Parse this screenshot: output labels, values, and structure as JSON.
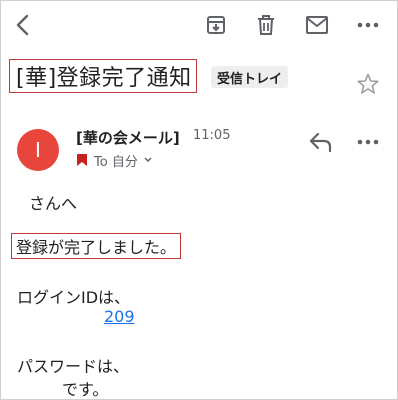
{
  "email": {
    "subject": "[華]登録完了通知",
    "label": "受信トレイ",
    "sender_initial": "I",
    "sender_name": "[華の会メール]",
    "time": "11:05",
    "recipient": "To 自分",
    "body": {
      "greeting": "さんへ",
      "message": "登録が完了しました。",
      "login_id_label": "ログインIDは、",
      "login_id_value": "209",
      "password_label": "パスワードは、",
      "password_suffix": "です。"
    }
  },
  "colors": {
    "avatar": "#e8453c",
    "highlight_border": "#c0393b",
    "link": "#1a73e8",
    "icon": "#5f6368"
  },
  "icons": {
    "back": "arrow-left-icon",
    "archive": "archive-icon",
    "delete": "trash-icon",
    "mark_unread": "mail-icon",
    "more": "more-horizontal-icon",
    "star": "star-icon",
    "reply": "reply-icon",
    "label_tag": "label-tag-icon",
    "chevron": "chevron-down-icon"
  }
}
